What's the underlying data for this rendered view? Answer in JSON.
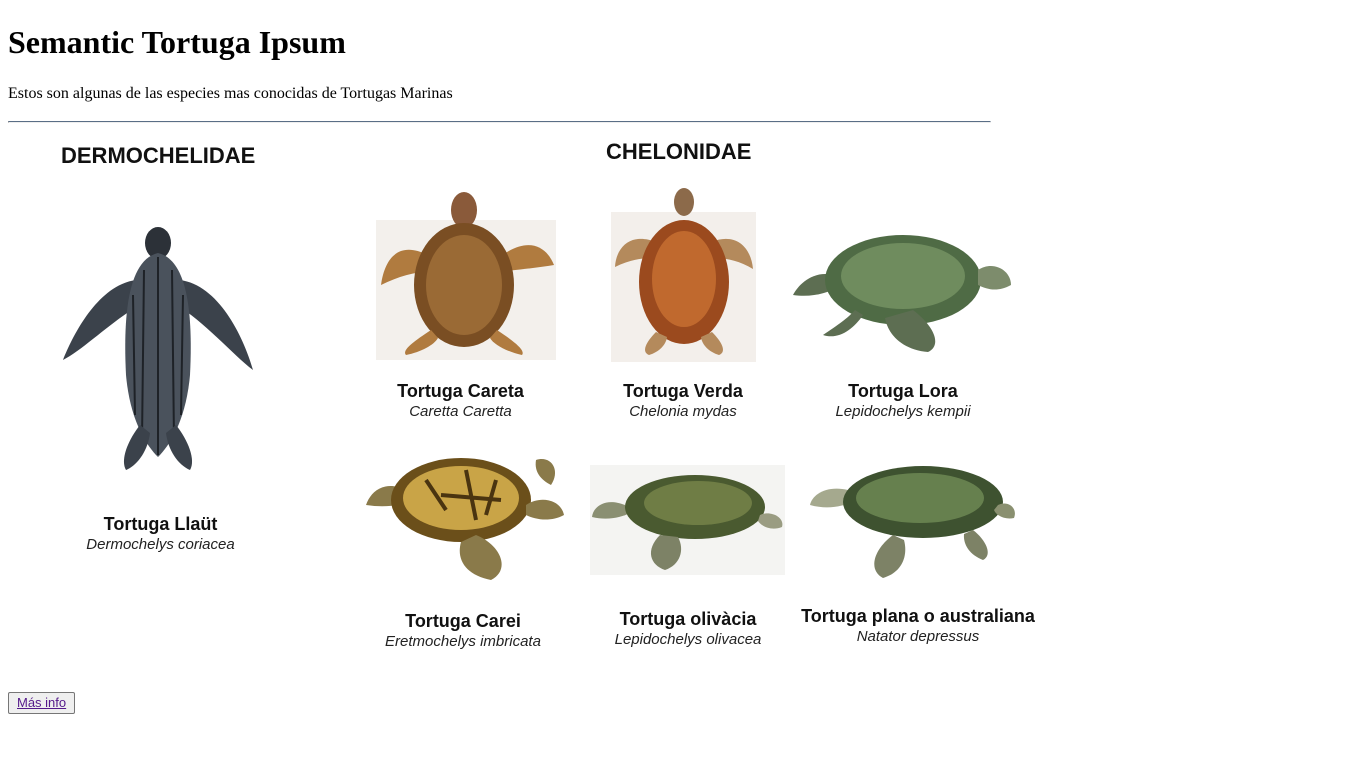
{
  "page": {
    "title": "Semantic Tortuga Ipsum",
    "intro": "Estos son algunas de las especies mas conocidas de Tortugas Marinas"
  },
  "figure": {
    "families": {
      "dermochelidae": "DERMOCHELIDAE",
      "chelonidae": "CHELONIDAE"
    },
    "species": [
      {
        "common": "Tortuga Llaüt",
        "scientific": "Dermochelys coriacea"
      },
      {
        "common": "Tortuga Careta",
        "scientific": "Caretta Caretta"
      },
      {
        "common": "Tortuga Verda",
        "scientific": "Chelonia mydas"
      },
      {
        "common": "Tortuga Lora",
        "scientific": "Lepidochelys kempii"
      },
      {
        "common": "Tortuga Carei",
        "scientific": "Eretmochelys imbricata"
      },
      {
        "common": "Tortuga olivàcia",
        "scientific": "Lepidochelys olivacea"
      },
      {
        "common": "Tortuga plana o australiana",
        "scientific": "Natator depressus"
      }
    ]
  },
  "actions": {
    "more_info": "Más info"
  }
}
